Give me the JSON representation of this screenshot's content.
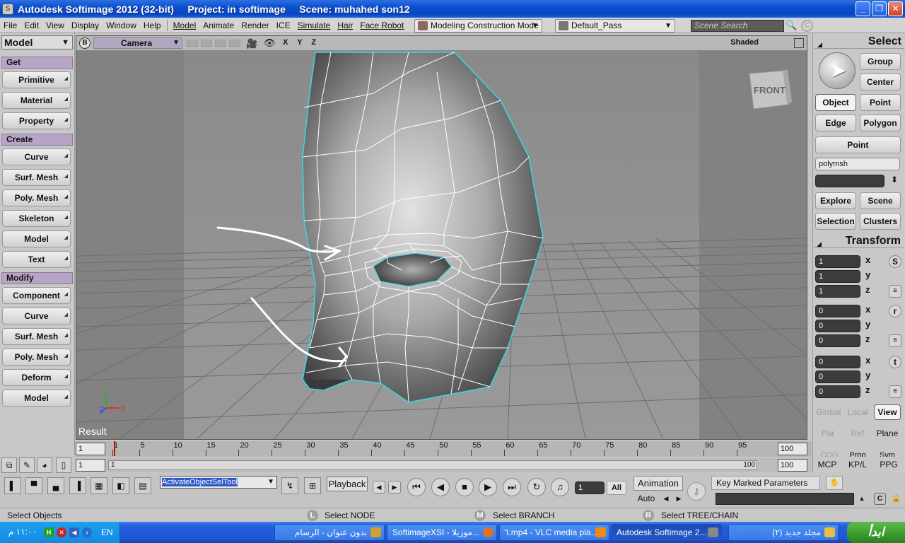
{
  "titlebar": {
    "title": "Autodesk Softimage 2012 (32-bit)     Project: in softimage     Scene: muhahed son12",
    "minimize": "_",
    "maximize": "❐",
    "close": "✕"
  },
  "menubar": {
    "items": [
      "File",
      "Edit",
      "View",
      "Display",
      "Window",
      "Help"
    ],
    "modules": [
      "Model",
      "Animate",
      "Render",
      "ICE",
      "Simulate",
      "Hair",
      "Face Robot"
    ],
    "construction_mode": "Modeling Construction Mode",
    "pass": "Default_Pass",
    "search_placeholder": "Scene Search"
  },
  "left_panel": {
    "mode": "Model",
    "sections": [
      {
        "label": "Get",
        "buttons": [
          "Primitive",
          "Material",
          "Property"
        ]
      },
      {
        "label": "Create",
        "buttons": [
          "Curve",
          "Surf. Mesh",
          "Poly. Mesh",
          "Skeleton",
          "Model",
          "Text"
        ]
      },
      {
        "label": "Modify",
        "buttons": [
          "Component",
          "Curve",
          "Surf. Mesh",
          "Poly. Mesh",
          "Deform",
          "Model"
        ]
      }
    ]
  },
  "viewport": {
    "b_button": "B",
    "camera": "Camera",
    "axes": "X Y Z",
    "shading": "Shaded",
    "cube_label": "FRONT",
    "result_label": "Result",
    "axis_y": "Y",
    "axis_z": "Z",
    "axis_x": "X"
  },
  "right_panel": {
    "select_head": "Select",
    "group": "Group",
    "center": "Center",
    "object": "Object",
    "point": "Point",
    "edge": "Edge",
    "polygon": "Polygon",
    "point2": "Point",
    "selection_name": "polymsh",
    "explore": "Explore",
    "scene": "Scene",
    "selection": "Selection",
    "clusters": "Clusters",
    "transform_head": "Transform",
    "scale": {
      "x": "1",
      "y": "1",
      "z": "1",
      "side": "S"
    },
    "rotate": {
      "x": "0",
      "y": "0",
      "z": "0",
      "side": "r"
    },
    "translate": {
      "x": "0",
      "y": "0",
      "z": "0",
      "side": "t"
    },
    "axis_x": "x",
    "axis_y": "y",
    "axis_z": "z",
    "global": "Global",
    "local": "Local",
    "view": "View",
    "par": "Par",
    "ref": "Ref",
    "plane": "Plane",
    "cog": "COG",
    "prop": "Prop",
    "sym": "Sym",
    "mcp": "MCP",
    "kpl": "KP/L",
    "ppg": "PPG"
  },
  "timeline": {
    "start": "1",
    "end": "100",
    "ticks": [
      "1",
      "5",
      "10",
      "15",
      "20",
      "25",
      "30",
      "35",
      "40",
      "45",
      "50",
      "55",
      "60",
      "65",
      "70",
      "75",
      "80",
      "85",
      "90",
      "95"
    ],
    "range_start": "1",
    "range_track_start": "1",
    "range_track_end": "100",
    "range_end": "100"
  },
  "controls": {
    "command": "ActivateObjectSelTool",
    "playback": "Playback",
    "frame": "1",
    "all": "All",
    "animation": "Animation",
    "auto": "Auto",
    "key_marked": "Key Marked Parameters"
  },
  "statusbar": {
    "main": "Select Objects",
    "l_badge": "L",
    "l_text": "Select NODE",
    "m_badge": "M",
    "m_text": "Select BRANCH",
    "r_badge": "R",
    "r_text": "Select TREE/CHAIN"
  },
  "taskbar": {
    "start": "ابدأ",
    "clock": "١١:٠٠ م",
    "lang": "EN",
    "tasks": [
      {
        "label": "بدون عنوان - الرسام",
        "color": "#d2a030"
      },
      {
        "label": "SoftimageXSI - موزيلا...",
        "color": "#e27020"
      },
      {
        "label": "٦.mp4 - VLC media pla...",
        "color": "#f08a10"
      },
      {
        "label": "Autodesk Softimage 2...",
        "color": "#888888"
      },
      {
        "label": "مجلد جديد (٢)",
        "color": "#e8c040"
      }
    ]
  },
  "colors": {
    "mesh_outline": "#36d8e8",
    "annotation": "#ffffff",
    "section_head": "#b8a4c4",
    "axis_x": "#d83030",
    "axis_y": "#30b030",
    "axis_z": "#3050d0"
  }
}
